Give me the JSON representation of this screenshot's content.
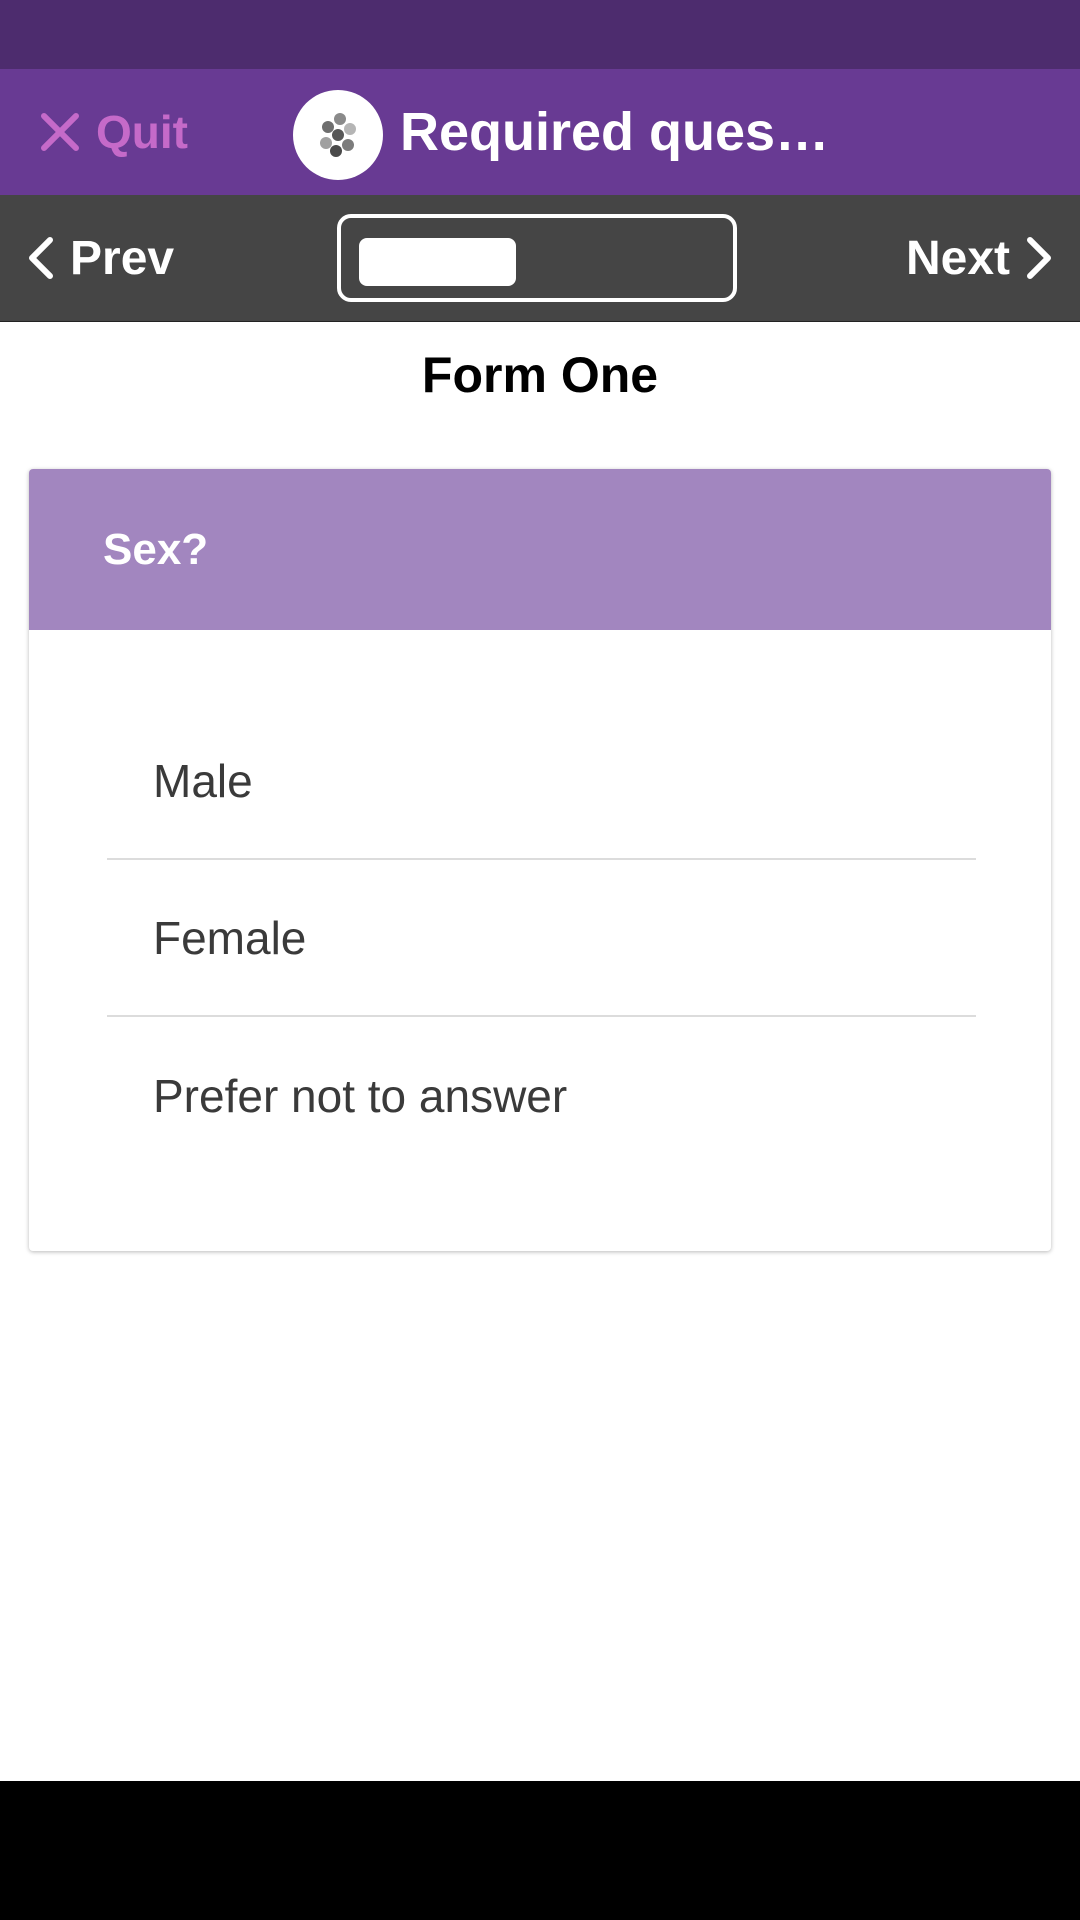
{
  "header": {
    "quit_label": "Quit",
    "title": "Required ques…"
  },
  "navigation": {
    "prev_label": "Prev",
    "next_label": "Next",
    "progress": 0.44
  },
  "form": {
    "title": "Form One",
    "question": "Sex?",
    "options": [
      "Male",
      "Female",
      "Prefer not to answer"
    ]
  },
  "colors": {
    "status_bar": "#4d2c6e",
    "app_bar": "#683a93",
    "nav_bar": "#454545",
    "question_header": "#a286bf",
    "quit_accent": "#c56ac9"
  }
}
